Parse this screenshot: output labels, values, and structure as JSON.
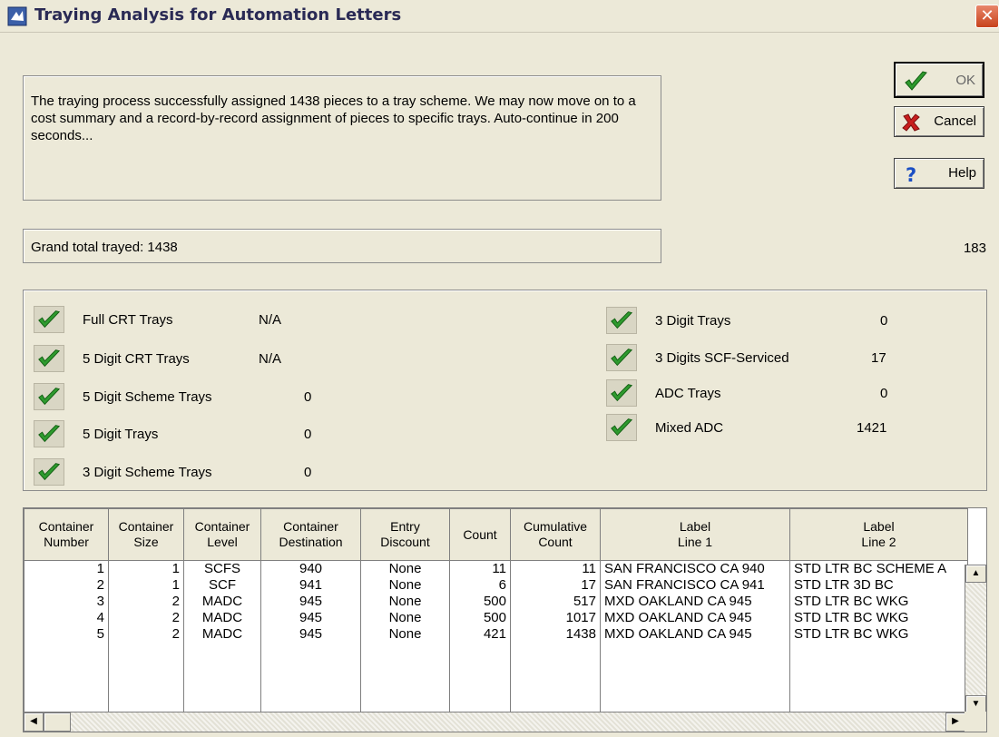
{
  "window": {
    "title": "Traying Analysis for Automation Letters",
    "close_glyph": "✕"
  },
  "message": "The traying process successfully assigned 1438 pieces to a tray scheme.  We may now move on to a cost summary and a record-by-record assignment of pieces to specific trays.  Auto-continue in 200 seconds...",
  "total": {
    "label": "Grand total trayed: 1438",
    "right_value": "183"
  },
  "buttons": {
    "ok": "OK",
    "cancel": "Cancel",
    "help": "Help"
  },
  "trays_left": [
    {
      "label": "Full CRT Trays",
      "value": "N/A"
    },
    {
      "label": "5 Digit CRT Trays",
      "value": "N/A"
    },
    {
      "label": "5 Digit Scheme Trays",
      "value": "0"
    },
    {
      "label": "5 Digit Trays",
      "value": "0"
    },
    {
      "label": "3 Digit Scheme Trays",
      "value": "0"
    }
  ],
  "trays_right": [
    {
      "label": "3 Digit Trays",
      "value": "0"
    },
    {
      "label": "3 Digits SCF-Serviced",
      "value": "17"
    },
    {
      "label": "ADC Trays",
      "value": "0"
    },
    {
      "label": "Mixed ADC",
      "value": "1421"
    }
  ],
  "table": {
    "headers": [
      [
        "Container",
        "Number"
      ],
      [
        "Container",
        "Size"
      ],
      [
        "Container",
        "Level"
      ],
      [
        "Container",
        "Destination"
      ],
      [
        "Entry",
        "Discount"
      ],
      [
        "Count",
        ""
      ],
      [
        "Cumulative",
        "Count"
      ],
      [
        "Label",
        "Line 1"
      ],
      [
        "Label",
        "Line 2"
      ]
    ],
    "rows": [
      [
        "1",
        "1",
        "SCFS",
        "940",
        "None",
        "11",
        "11",
        "SAN FRANCISCO CA 940",
        "STD LTR BC SCHEME A"
      ],
      [
        "2",
        "1",
        "SCF",
        "941",
        "None",
        "6",
        "17",
        "SAN FRANCISCO CA 941",
        "STD LTR 3D BC"
      ],
      [
        "3",
        "2",
        "MADC",
        "945",
        "None",
        "500",
        "517",
        "MXD OAKLAND CA 945",
        "STD LTR BC WKG"
      ],
      [
        "4",
        "2",
        "MADC",
        "945",
        "None",
        "500",
        "1017",
        "MXD OAKLAND CA 945",
        "STD LTR BC WKG"
      ],
      [
        "5",
        "2",
        "MADC",
        "945",
        "None",
        "421",
        "1438",
        "MXD OAKLAND CA 945",
        "STD LTR BC WKG"
      ]
    ]
  },
  "icons": {
    "window": "app-icon",
    "check": "checkmark-icon",
    "cancel": "x-icon",
    "help": "question-icon"
  },
  "colors": {
    "background": "#ece9d8",
    "check_green": "#2e9a2e",
    "cancel_red": "#c81e1e",
    "help_blue": "#1b4fc4"
  }
}
